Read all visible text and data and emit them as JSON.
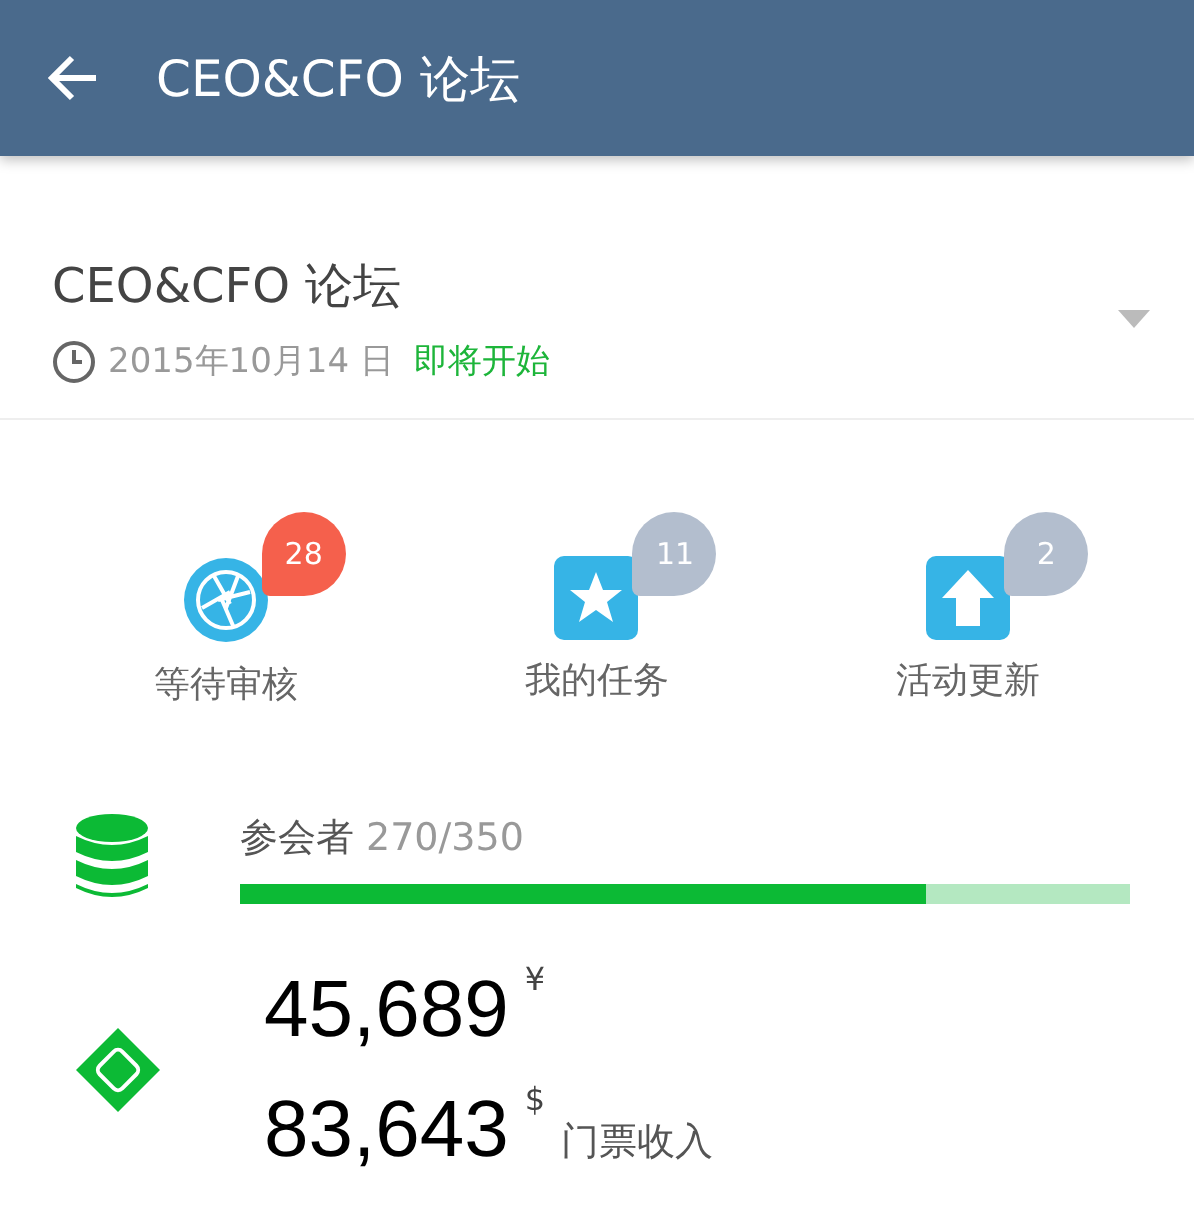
{
  "app_bar": {
    "title": "CEO&CFO 论坛"
  },
  "event": {
    "title": "CEO&CFO 论坛",
    "date": "2015年10月14 日",
    "status": "即将开始"
  },
  "shortcuts": [
    {
      "kind": "aperture",
      "label": "等待审核",
      "count": "28",
      "color": "#f5604c"
    },
    {
      "kind": "star",
      "label": "我的任务",
      "count": "11",
      "color": "#b3bece"
    },
    {
      "kind": "upload",
      "label": "活动更新",
      "count": "2",
      "color": "#b3bece"
    }
  ],
  "attendees": {
    "label": "参会者",
    "reading": "270/350",
    "level": 0.771
  },
  "revenue": {
    "amounts": [
      {
        "value": "45,689",
        "currency": "¥"
      },
      {
        "value": "83,643",
        "currency": "$",
        "caption": "门票收入"
      }
    ]
  }
}
